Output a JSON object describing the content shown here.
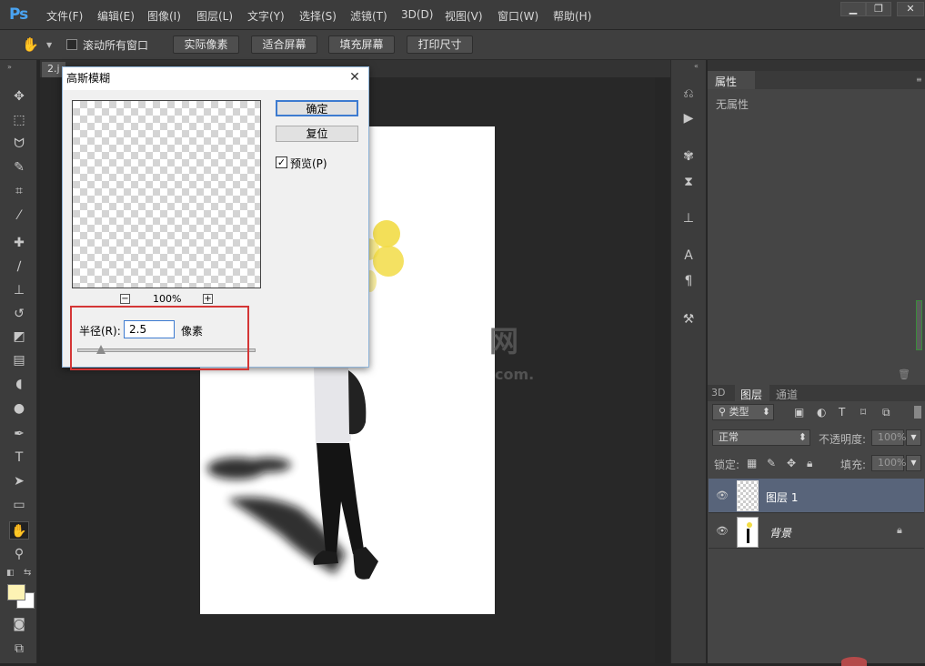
{
  "app": {
    "logo": "Ps"
  },
  "menu": [
    "文件(F)",
    "编辑(E)",
    "图像(I)",
    "图层(L)",
    "文字(Y)",
    "选择(S)",
    "滤镜(T)",
    "3D(D)",
    "视图(V)",
    "窗口(W)",
    "帮助(H)"
  ],
  "window_controls": {
    "minimize": "▁",
    "restore": "❐",
    "close": "✕"
  },
  "options_bar": {
    "scroll_all_windows_label": "滚动所有窗口",
    "scroll_all_windows_checked": false,
    "buttons": [
      "实际像素",
      "适合屏幕",
      "填充屏幕",
      "打印尺寸"
    ]
  },
  "document_tab": {
    "label": "2.j"
  },
  "properties_panel": {
    "title": "属性",
    "empty_text": "无属性"
  },
  "layers_panel": {
    "tabs": [
      "3D",
      "图层",
      "通道"
    ],
    "active_tab": "图层",
    "filter_label": "类型",
    "blend_mode": "正常",
    "opacity_label": "不透明度:",
    "opacity_value": "100%",
    "lock_label": "锁定:",
    "fill_label": "填充:",
    "fill_value": "100%",
    "layers": [
      {
        "name": "图层 1",
        "selected": true,
        "locked": false
      },
      {
        "name": "背景",
        "selected": false,
        "locked": true
      }
    ]
  },
  "dialog": {
    "title": "高斯模糊",
    "ok_label": "确定",
    "reset_label": "复位",
    "preview_label": "预览(P)",
    "preview_checked": true,
    "zoom_level": "100%",
    "zoom_out": "−",
    "zoom_in": "+",
    "radius_label": "半径(R):",
    "radius_value": "2.5",
    "radius_unit": "像素"
  },
  "watermark": {
    "line1": "网",
    "line2": "com."
  },
  "colors": {
    "foreground": "#fdf3b4",
    "background": "#ffffff",
    "highlight": "#d43636",
    "accent": "#4aa4f2"
  }
}
